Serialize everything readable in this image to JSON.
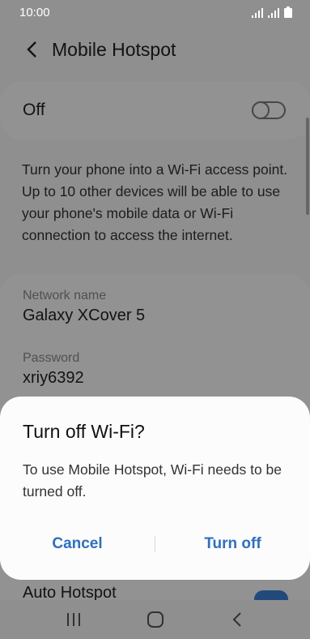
{
  "status_bar": {
    "time": "10:00"
  },
  "app_bar": {
    "title": "Mobile Hotspot"
  },
  "toggle": {
    "label": "Off",
    "state": "off"
  },
  "description": "Turn your phone into a Wi-Fi access point. Up to 10 other devices will be able to use your phone's mobile data or Wi-Fi connection to access the internet.",
  "network": {
    "name_label": "Network name",
    "name_value": "Galaxy XCover 5",
    "password_label": "Password",
    "password_value": "xriy6392"
  },
  "auto_hotspot": {
    "label": "Auto Hotspot"
  },
  "dialog": {
    "title": "Turn off Wi-Fi?",
    "message": "To use Mobile Hotspot, Wi-Fi needs to be turned off.",
    "cancel": "Cancel",
    "confirm": "Turn off"
  },
  "colors": {
    "accent": "#2f6fbf",
    "scrim": "rgba(0,0,0,0.42)"
  }
}
